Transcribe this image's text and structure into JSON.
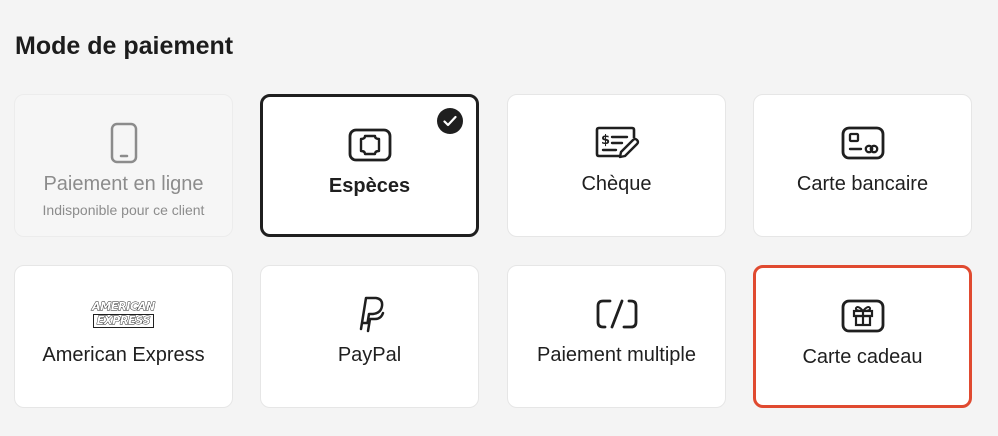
{
  "section_title": "Mode de paiement",
  "colors": {
    "selected_border": "#1f1f1f",
    "highlight_border": "#e04a30",
    "disabled_text": "#8c8c8c"
  },
  "methods": [
    {
      "label": "Paiement en ligne",
      "sublabel": "Indisponible pour ce client",
      "icon": "smartphone-icon",
      "state": "disabled"
    },
    {
      "label": "Espèces",
      "icon": "banknote-icon",
      "state": "selected"
    },
    {
      "label": "Chèque",
      "icon": "cheque-icon",
      "state": "default"
    },
    {
      "label": "Carte bancaire",
      "icon": "credit-card-icon",
      "state": "default"
    },
    {
      "label": "American Express",
      "icon": "american-express-logo",
      "logo_text": [
        "AMERICAN",
        "EXPRESS"
      ],
      "state": "default"
    },
    {
      "label": "PayPal",
      "icon": "paypal-icon",
      "state": "default"
    },
    {
      "label": "Paiement multiple",
      "icon": "split-payment-icon",
      "state": "default"
    },
    {
      "label": "Carte cadeau",
      "icon": "gift-card-icon",
      "state": "highlighted"
    }
  ]
}
